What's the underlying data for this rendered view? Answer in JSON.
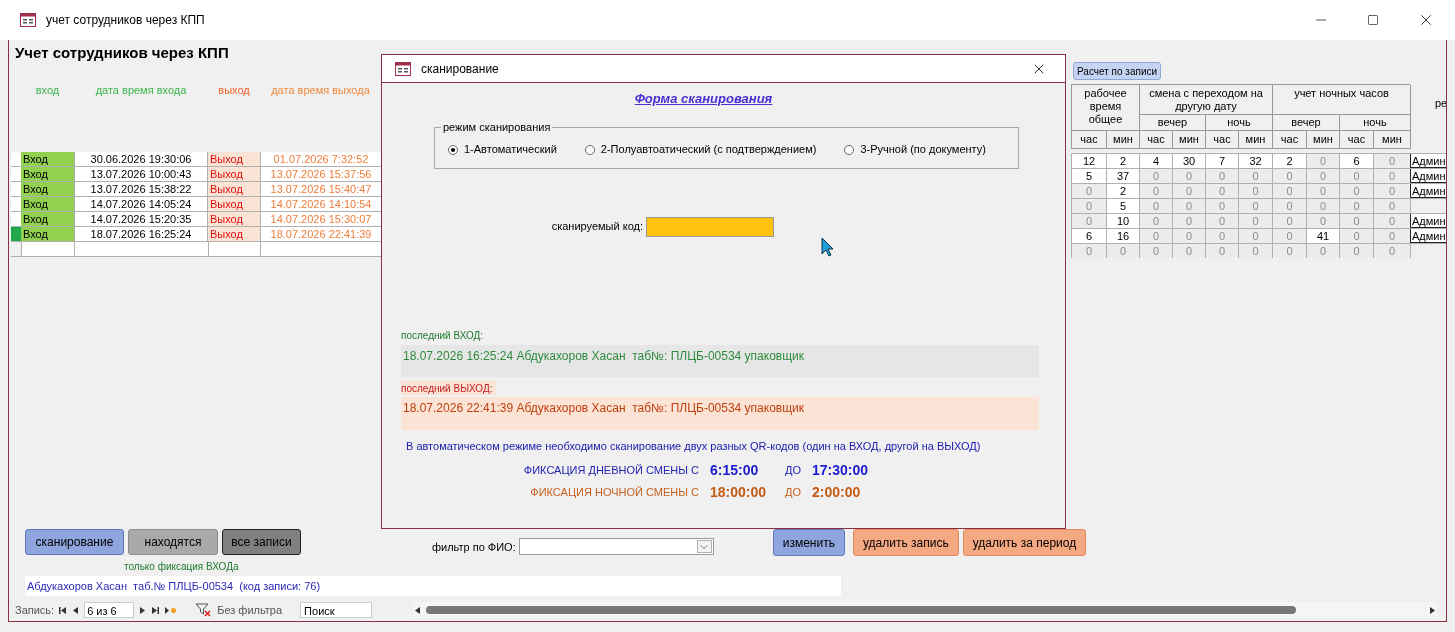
{
  "window": {
    "title": "учет сотрудников через КПП"
  },
  "form_title": "Учет сотрудников через КПП",
  "left_table": {
    "columns": [
      "вход",
      "дата время входа",
      "выход",
      "дата время выхода"
    ],
    "rows": [
      {
        "selected": false,
        "entry": "Вход",
        "entry_time": "30.06.2026 19:30:06",
        "exit": "Выход",
        "exit_time": "01.07.2026 7:32:52"
      },
      {
        "selected": false,
        "entry": "Вход",
        "entry_time": "13.07.2026 10:00:43",
        "exit": "Выход",
        "exit_time": "13.07.2026 15:37:56"
      },
      {
        "selected": false,
        "entry": "Вход",
        "entry_time": "13.07.2026 15:38:22",
        "exit": "Выход",
        "exit_time": "13.07.2026 15:40:47"
      },
      {
        "selected": false,
        "entry": "Вход",
        "entry_time": "14.07.2026 14:05:24",
        "exit": "Выход",
        "exit_time": "14.07.2026 14:10:54"
      },
      {
        "selected": false,
        "entry": "Вход",
        "entry_time": "14.07.2026 15:20:35",
        "exit": "Выход",
        "exit_time": "14.07.2026 15:30:07"
      },
      {
        "selected": true,
        "entry": "Вход",
        "entry_time": "18.07.2026 16:25:24",
        "exit": "Выход",
        "exit_time": "18.07.2026 22:41:39"
      }
    ]
  },
  "calc_button": "Расчет по записи",
  "right_table": {
    "groups": [
      {
        "label": "рабочее время общее"
      },
      {
        "label": "смена с переходом на другую дату",
        "subgroups": [
          "вечер",
          "ночь"
        ]
      },
      {
        "label": "учет ночных часов",
        "subgroups": [
          "вечер",
          "ночь"
        ]
      }
    ],
    "units": [
      "час",
      "мин",
      "час",
      "мин",
      "час",
      "мин",
      "час",
      "мин",
      "час",
      "мин"
    ],
    "column_11": "ре",
    "rows": [
      {
        "cells": [
          {
            "value": "12",
            "dim": false
          },
          {
            "value": "2",
            "dim": false
          },
          {
            "value": "4",
            "dim": false
          },
          {
            "value": "30",
            "dim": false
          },
          {
            "value": "7",
            "dim": false
          },
          {
            "value": "32",
            "dim": false
          },
          {
            "value": "2",
            "dim": false
          },
          {
            "value": "0",
            "dim": true
          },
          {
            "value": "6",
            "dim": false
          },
          {
            "value": "0",
            "dim": true
          }
        ],
        "column_11": "Админ"
      },
      {
        "cells": [
          {
            "value": "5",
            "dim": false
          },
          {
            "value": "37",
            "dim": false
          },
          {
            "value": "0",
            "dim": true
          },
          {
            "value": "0",
            "dim": true
          },
          {
            "value": "0",
            "dim": true
          },
          {
            "value": "0",
            "dim": true
          },
          {
            "value": "0",
            "dim": true
          },
          {
            "value": "0",
            "dim": true
          },
          {
            "value": "0",
            "dim": true
          },
          {
            "value": "0",
            "dim": true
          }
        ],
        "column_11": "Админ"
      },
      {
        "cells": [
          {
            "value": "0",
            "dim": true
          },
          {
            "value": "2",
            "dim": false
          },
          {
            "value": "0",
            "dim": true
          },
          {
            "value": "0",
            "dim": true
          },
          {
            "value": "0",
            "dim": true
          },
          {
            "value": "0",
            "dim": true
          },
          {
            "value": "0",
            "dim": true
          },
          {
            "value": "0",
            "dim": true
          },
          {
            "value": "0",
            "dim": true
          },
          {
            "value": "0",
            "dim": true
          }
        ],
        "column_11": "Админ"
      },
      {
        "cells": [
          {
            "value": "0",
            "dim": true
          },
          {
            "value": "5",
            "dim": false
          },
          {
            "value": "0",
            "dim": true
          },
          {
            "value": "0",
            "dim": true
          },
          {
            "value": "0",
            "dim": true
          },
          {
            "value": "0",
            "dim": true
          },
          {
            "value": "0",
            "dim": true
          },
          {
            "value": "0",
            "dim": true
          },
          {
            "value": "0",
            "dim": true
          },
          {
            "value": "0",
            "dim": true
          }
        ]
      },
      {
        "cells": [
          {
            "value": "0",
            "dim": true
          },
          {
            "value": "10",
            "dim": false
          },
          {
            "value": "0",
            "dim": true
          },
          {
            "value": "0",
            "dim": true
          },
          {
            "value": "0",
            "dim": true
          },
          {
            "value": "0",
            "dim": true
          },
          {
            "value": "0",
            "dim": true
          },
          {
            "value": "0",
            "dim": true
          },
          {
            "value": "0",
            "dim": true
          },
          {
            "value": "0",
            "dim": true
          }
        ],
        "column_11": "Админ"
      },
      {
        "cells": [
          {
            "value": "6",
            "dim": false
          },
          {
            "value": "16",
            "dim": false
          },
          {
            "value": "0",
            "dim": true
          },
          {
            "value": "0",
            "dim": true
          },
          {
            "value": "0",
            "dim": true
          },
          {
            "value": "0",
            "dim": true
          },
          {
            "value": "0",
            "dim": true
          },
          {
            "value": "41",
            "dim": false
          },
          {
            "value": "0",
            "dim": true
          },
          {
            "value": "0",
            "dim": true
          }
        ],
        "column_11": "Админ"
      },
      {
        "cells": [
          {
            "value": "0",
            "dim": true
          },
          {
            "value": "0",
            "dim": true
          },
          {
            "value": "0",
            "dim": true
          },
          {
            "value": "0",
            "dim": true
          },
          {
            "value": "0",
            "dim": true
          },
          {
            "value": "0",
            "dim": true
          },
          {
            "value": "0",
            "dim": true
          },
          {
            "value": "0",
            "dim": true
          },
          {
            "value": "0",
            "dim": true
          },
          {
            "value": "0",
            "dim": true
          }
        ]
      }
    ]
  },
  "scan_dialog": {
    "title": "сканирование",
    "heading": "Форма сканирования",
    "mode_group": {
      "label": "режим сканирования",
      "options": [
        {
          "label": "1-Автоматический",
          "selected": true
        },
        {
          "label": "2-Полуавтоатический (с подтверждением)",
          "selected": false
        },
        {
          "label": "3-Ручной (по документу)",
          "selected": false
        }
      ]
    },
    "code_field": {
      "label": "сканируемый код:"
    },
    "last_entry": {
      "label": "последний ВХОД:",
      "text": "18.07.2026 16:25:24 Абдукахоров Хасан  таб№: ПЛЦБ-00534 упаковщик"
    },
    "last_exit": {
      "label": "последний ВЫХОД:",
      "text": "18.07.2026 22:41:39 Абдукахоров Хасан  таб№: ПЛЦБ-00534 упаковщик"
    },
    "note": "В автоматическом режиме необходимо сканирование двух разных QR-кодов (один на ВХОД, другой на ВЫХОД)",
    "shifts": [
      {
        "kind": "day",
        "label": "ФИКСАЦИЯ ДНЕВНОЙ СМЕНЫ С",
        "from": "6:15:00",
        "to_label": "ДО",
        "to": "17:30:00"
      },
      {
        "kind": "night",
        "label": "ФИКСАЦИЯ НОЧНОЙ СМЕНЫ С",
        "from": "18:00:00",
        "to_label": "ДО",
        "to": "2:00:00"
      }
    ]
  },
  "left_buttons": [
    {
      "label": "сканирование",
      "kind": "primary"
    },
    {
      "label": "находятся",
      "kind": "neutral"
    },
    {
      "label": "все записи",
      "kind": "dark"
    }
  ],
  "hint": "только фиксация ВХОДа",
  "filter": {
    "label": "фильтр по ФИО:"
  },
  "right_buttons": [
    {
      "label": "изменить",
      "kind": "primary"
    },
    {
      "label": "удалить запись",
      "kind": "danger"
    },
    {
      "label": "удалить за период",
      "kind": "danger"
    }
  ],
  "status_text": "Абдукахоров Хасан  таб.№ ПЛЦБ-00534  (код записи: 76)",
  "navigator": {
    "label": "Запись:",
    "position": "6 из 6",
    "filter_state": "Без фильтра",
    "search": "Поиск"
  }
}
